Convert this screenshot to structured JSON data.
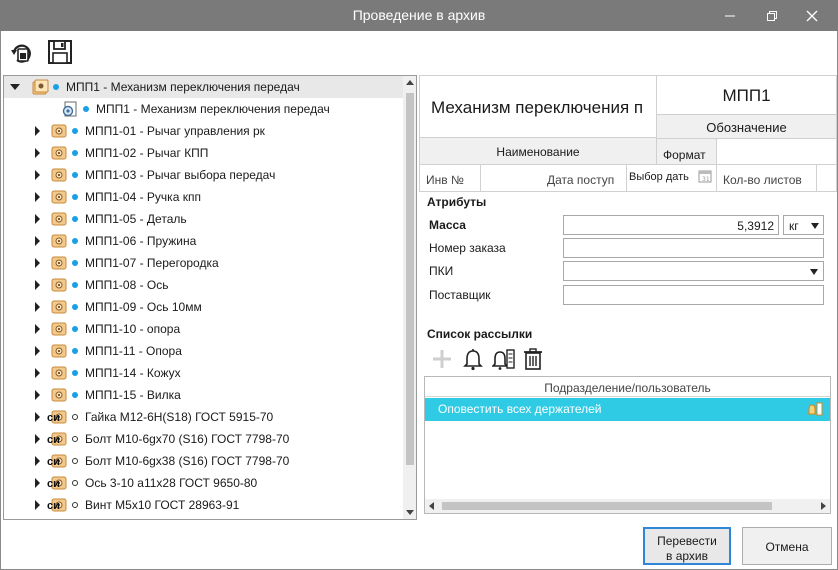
{
  "window": {
    "title": "Проведение в архив"
  },
  "toolbar": {
    "items": [
      "archive-icon",
      "save-icon"
    ]
  },
  "tree": {
    "rows": [
      {
        "label": "МПП1 - Механизм переключения передач",
        "level": 0,
        "expanded": true,
        "selected": true,
        "icon": "assembly-icon",
        "dot": "filled"
      },
      {
        "label": "МПП1 - Механизм переключения передач",
        "level": 1,
        "expanded": null,
        "icon": "document-icon",
        "dot": "filled"
      },
      {
        "label": "МПП1-01 - Рычаг управления рк",
        "level": 1,
        "expanded": false,
        "icon": "part-icon",
        "dot": "filled"
      },
      {
        "label": "МПП1-02 - Рычаг КПП",
        "level": 1,
        "expanded": false,
        "icon": "part-icon",
        "dot": "filled"
      },
      {
        "label": "МПП1-03 - Рычаг выбора передач",
        "level": 1,
        "expanded": false,
        "icon": "part-icon",
        "dot": "filled"
      },
      {
        "label": "МПП1-04 - Ручка кпп",
        "level": 1,
        "expanded": false,
        "icon": "part-icon",
        "dot": "filled"
      },
      {
        "label": "МПП1-05 - Деталь",
        "level": 1,
        "expanded": false,
        "icon": "part-icon",
        "dot": "filled"
      },
      {
        "label": "МПП1-06 - Пружина",
        "level": 1,
        "expanded": false,
        "icon": "part-icon",
        "dot": "filled"
      },
      {
        "label": "МПП1-07 - Перегородка",
        "level": 1,
        "expanded": false,
        "icon": "part-icon",
        "dot": "filled"
      },
      {
        "label": "МПП1-08 - Ось",
        "level": 1,
        "expanded": false,
        "icon": "part-icon",
        "dot": "filled"
      },
      {
        "label": "МПП1-09 - Ось 10мм",
        "level": 1,
        "expanded": false,
        "icon": "part-icon",
        "dot": "filled"
      },
      {
        "label": "МПП1-10 - опора",
        "level": 1,
        "expanded": false,
        "icon": "part-icon",
        "dot": "filled"
      },
      {
        "label": "МПП1-11 - Опора",
        "level": 1,
        "expanded": false,
        "icon": "part-icon",
        "dot": "filled"
      },
      {
        "label": "МПП1-14 - Кожух",
        "level": 1,
        "expanded": false,
        "icon": "part-icon",
        "dot": "filled"
      },
      {
        "label": "МПП1-15 - Вилка",
        "level": 1,
        "expanded": false,
        "icon": "part-icon",
        "dot": "filled"
      },
      {
        "label": "Гайка М12-6Н(S18) ГОСТ 5915-70",
        "level": 1,
        "expanded": false,
        "icon": "standard-part-icon",
        "badge": "СИ",
        "dot": "hollow"
      },
      {
        "label": "Болт М10-6gx70 (S16) ГОСТ 7798-70",
        "level": 1,
        "expanded": false,
        "icon": "standard-part-icon",
        "badge": "СИ",
        "dot": "hollow"
      },
      {
        "label": "Болт М10-6gx38 (S16) ГОСТ 7798-70",
        "level": 1,
        "expanded": false,
        "icon": "standard-part-icon",
        "badge": "СИ",
        "dot": "hollow"
      },
      {
        "label": "Ось 3-10 а11х28 ГОСТ 9650-80",
        "level": 1,
        "expanded": false,
        "icon": "standard-part-icon",
        "badge": "СИ",
        "dot": "hollow"
      },
      {
        "label": "Винт М5х10 ГОСТ 28963-91",
        "level": 1,
        "expanded": false,
        "icon": "standard-part-icon",
        "badge": "СИ",
        "dot": "hollow"
      }
    ]
  },
  "stamp": {
    "name_value": "Механизм переключения п",
    "designation_value": "МПП1",
    "designation_label": "Обозначение",
    "name_label": "Наименование",
    "format_label": "Формат",
    "inv_label": "Инв №",
    "date_label": "Дата поступ",
    "date_placeholder": "Выбор дать",
    "sheets_label": "Кол-во листов"
  },
  "attributes": {
    "title": "Атрибуты",
    "mass_label": "Масса",
    "mass_value": "5,3912",
    "mass_unit": "кг",
    "order_label": "Номер заказа",
    "pki_label": "ПКИ",
    "supplier_label": "Поставщик"
  },
  "mailing": {
    "title": "Список рассылки",
    "column_header": "Подразделение/пользователь",
    "rows": [
      "Оповестить всех держателей"
    ]
  },
  "buttons": {
    "transfer": "Перевести в архив",
    "cancel": "Отмена"
  },
  "colors": {
    "titlebar": "#7a7a7a",
    "selection_accent": "#2fcbe4",
    "dot": "#1aa0e6",
    "primary_border": "#2f86d6"
  }
}
